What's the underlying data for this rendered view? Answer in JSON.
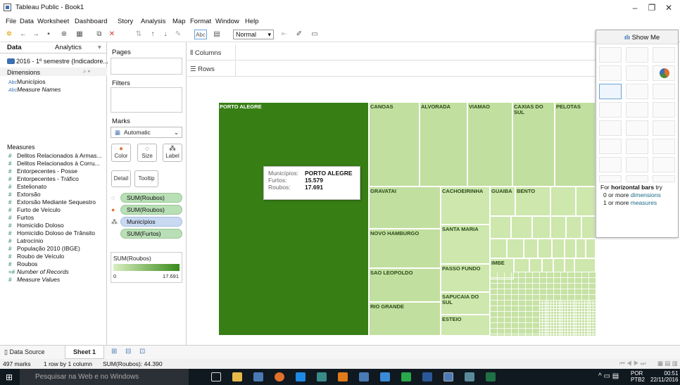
{
  "window": {
    "title": "Tableau Public - Book1",
    "controls": [
      "–",
      "❐",
      "✕"
    ]
  },
  "menu": [
    "File",
    "Data",
    "Worksheet",
    "Dashboard",
    "Story",
    "Analysis",
    "Map",
    "Format",
    "Window",
    "Help"
  ],
  "toolbar": {
    "fit_select": "Normal",
    "abc_label": "Abc"
  },
  "left_tabs": {
    "data": "Data",
    "analytics": "Analytics"
  },
  "datasource": "2016 - 1º semestre (Indicadore...",
  "dimensions": {
    "header": "Dimensions",
    "items": [
      "Municípios",
      "Measure Names"
    ]
  },
  "measures": {
    "header": "Measures",
    "items": [
      "Delitos Relacionados à Armas...",
      "Delitos Relacionados à Corru...",
      "Entorpecentes - Posse",
      "Entorpecentes - Tráfico",
      "Estelionato",
      "Extorsão",
      "Extorsão Mediante Sequestro",
      "Furto de Veículo",
      "Furtos",
      "Homicídio  Doloso",
      "Homicídio Doloso de Trânsito",
      "Latrocínio",
      "População 2010 (IBGE)",
      "Roubo de Veículo",
      "Roubos",
      "Number of Records",
      "Measure Values"
    ]
  },
  "cards": {
    "pages": "Pages",
    "filters": "Filters",
    "marks": "Marks",
    "mark_type": "Automatic"
  },
  "mark_buttons": {
    "color": "Color",
    "size": "Size",
    "label": "Label",
    "detail": "Detail",
    "tooltip": "Tooltip"
  },
  "mark_pills": [
    "SUM(Roubos)",
    "SUM(Roubos)",
    "Municípios",
    "SUM(Furtos)"
  ],
  "legend": {
    "title": "SUM(Roubos)",
    "min": "0",
    "max": "17.691",
    "color_low": "#d9efc0",
    "color_high": "#3a8a1a"
  },
  "shelves": {
    "columns": "Columns",
    "rows": "Rows"
  },
  "treemap_labels": {
    "porto_alegre": "PORTO ALEGRE",
    "canoas": "CANOAS",
    "alvorada": "ALVORADA",
    "viamao": "VIAMAO",
    "caxias": "CAXIAS DO SUL",
    "pelotas": "PELOTAS",
    "gravatai": "GRAVATAI",
    "cachoeirinha": "CACHOEIRINHA",
    "guaiba": "GUAIBA",
    "bento": "BENTO",
    "novo_hamburgo": "NOVO HAMBURGO",
    "santa_maria": "SANTA MARIA",
    "sao_leopoldo": "SAO LEOPOLDO",
    "passo_fundo": "PASSO FUNDO",
    "imbe": "IMBE",
    "sapucaia": "SAPUCAIA DO SUL",
    "rio_grande": "RIO GRANDE",
    "esteio": "ESTEIO"
  },
  "tooltip": {
    "k1": "Municípios:",
    "v1": "PORTO ALEGRE",
    "k2": "Furtos:",
    "v2": "15.579",
    "k3": "Roubos:",
    "v3": "17.691"
  },
  "show_me": {
    "title": "Show Me",
    "hint_prefix": "For ",
    "hint_bold": "horizontal bars",
    "hint_mid": " try",
    "hint_l2a": "0 or more ",
    "hint_l2b": "dimensions",
    "hint_l3a": "1 or more ",
    "hint_l3b": "measures"
  },
  "bottom_tabs": {
    "data_source": "Data Source",
    "sheet": "Sheet 1"
  },
  "status": {
    "marks": "497 marks",
    "rows": "1 row by 1 column",
    "sum": "SUM(Roubos): 44.390"
  },
  "taskbar": {
    "search": "Pesquisar na Web e no Windows",
    "lang1": "POR",
    "lang2": "PTB2",
    "time": "00:51",
    "date": "22/11/2016"
  }
}
